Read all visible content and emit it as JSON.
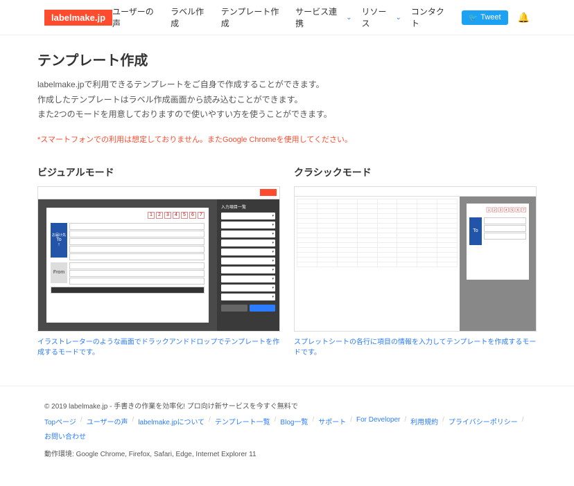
{
  "header": {
    "logo": "labelmake.jp",
    "nav": {
      "users_voice": "ユーザーの声",
      "label_create": "ラベル作成",
      "template_create": "テンプレート作成",
      "service_link": "サービス連携",
      "resource": "リソース",
      "contact": "コンタクト"
    },
    "tweet": "Tweet"
  },
  "page": {
    "title": "テンプレート作成",
    "desc1": "labelmake.jpで利用できるテンプレートをご自身で作成することができます。",
    "desc2": "作成したテンプレートはラベル作成画面から読み込むことができます。",
    "desc3": "また2つのモードを用意しておりますので使いやすい方を使うことができます。",
    "warning": "*スマートフォンでの利用は想定しておりません。またGoogle Chromeを使用してください。"
  },
  "visual": {
    "title": "ビジュアルモード",
    "nums": [
      "1",
      "2",
      "3",
      "4",
      "5",
      "6",
      "7"
    ],
    "to": "To",
    "from": "From",
    "panel_title": "入力項目一覧",
    "caption": "イラストレーターのような画面でドラックアンドドロップでテンプレートを作成するモードです。"
  },
  "classic": {
    "title": "クラシックモード",
    "caption": "スプレットシートの各行に項目の情報を入力してテンプレートを作成するモードです。"
  },
  "footer": {
    "copyright": "© 2019 labelmake.jp - 手書きの作業を効率化! プロ向け新サービスを今すぐ無料で",
    "links": {
      "top": "Topページ",
      "voice": "ユーザーの声",
      "about": "labelmake.jpについて",
      "templates": "テンプレート一覧",
      "blog": "Blog一覧",
      "support": "サポート",
      "developer": "For Developer",
      "terms": "利用規約",
      "privacy": "プライバシーポリシー",
      "inquiry": "お問い合わせ"
    },
    "env_label": "動作環境:",
    "env": "Google Chrome, Firefox, Safari, Edge, Internet Explorer 11"
  }
}
